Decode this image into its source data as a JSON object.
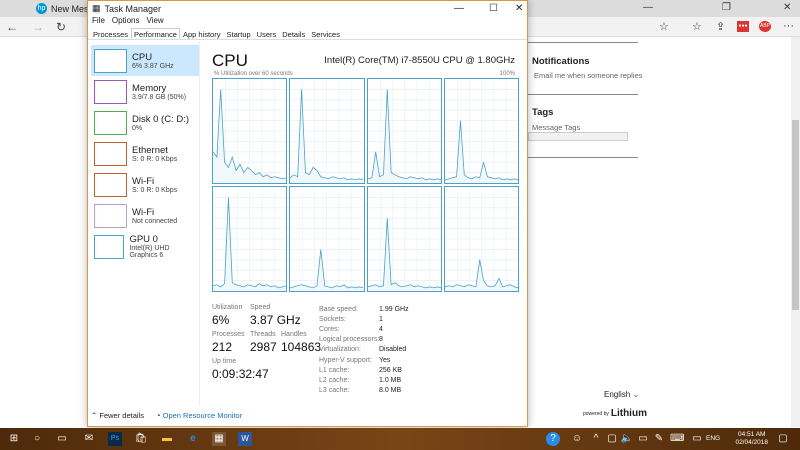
{
  "browser": {
    "tab_title": "New Message",
    "heading_notifications": "Notifications",
    "email_option": "Email me when someone replies",
    "heading_tags": "Tags",
    "tags_label": "Message Tags",
    "language": "English",
    "powered_by": "powered by",
    "brand": "Lithium"
  },
  "taskmgr": {
    "title": "Task Manager",
    "menu": [
      "File",
      "Options",
      "View"
    ],
    "tabs": [
      "Processes",
      "Performance",
      "App history",
      "Startup",
      "Users",
      "Details",
      "Services"
    ],
    "active_tab": 1,
    "sidebar": [
      {
        "name": "CPU",
        "sub": "6% 3.87 GHz",
        "color": "#4ba1c6"
      },
      {
        "name": "Memory",
        "sub": "3.9/7.8 GB (50%)",
        "color": "#9b59b6"
      },
      {
        "name": "Disk 0 (C: D:)",
        "sub": "0%",
        "color": "#4caf50"
      },
      {
        "name": "Ethernet",
        "sub": "S: 0 R: 0 Kbps",
        "color": "#c0622b"
      },
      {
        "name": "Wi-Fi",
        "sub": "S: 0 R: 0 Kbps",
        "color": "#c0622b"
      },
      {
        "name": "Wi-Fi",
        "sub": "Not connected",
        "color": "#c0a0c0"
      },
      {
        "name": "GPU 0",
        "sub": "Intel(R) UHD Graphics 6",
        "color": "#4ba1c6"
      }
    ],
    "main": {
      "title": "CPU",
      "cpu_name": "Intel(R) Core(TM) i7-8550U CPU @ 1.80GHz",
      "graph_label": "% Utilization over 60 seconds",
      "graph_max": "100%",
      "stats": {
        "util_label": "Utilization",
        "util": "6%",
        "speed_label": "Speed",
        "speed": "3.87 GHz",
        "proc_label": "Processes",
        "proc": "212",
        "threads_label": "Threads",
        "threads": "2987",
        "handles_label": "Handles",
        "handles": "104863",
        "uptime_label": "Up time",
        "uptime": "0:09:32:47"
      },
      "details": [
        [
          "Base speed:",
          "1.99 GHz"
        ],
        [
          "Sockets:",
          "1"
        ],
        [
          "Cores:",
          "4"
        ],
        [
          "Logical processors:",
          "8"
        ],
        [
          "Virtualization:",
          "Disabled"
        ],
        [
          "Hyper-V support:",
          "Yes"
        ],
        [
          "L1 cache:",
          "256 KB"
        ],
        [
          "L2 cache:",
          "1.0 MB"
        ],
        [
          "L3 cache:",
          "8.0 MB"
        ]
      ]
    },
    "footer": {
      "fewer": "Fewer details",
      "monitor": "Open Resource Monitor"
    },
    "core_utilization": [
      [
        30,
        25,
        90,
        20,
        15,
        25,
        12,
        18,
        10,
        15,
        12,
        8,
        10,
        6,
        8,
        5,
        6,
        5,
        4,
        5
      ],
      [
        5,
        8,
        6,
        90,
        10,
        8,
        15,
        12,
        6,
        5,
        4,
        6,
        5,
        4,
        5,
        3,
        4,
        3,
        4,
        3
      ],
      [
        4,
        5,
        30,
        6,
        8,
        90,
        10,
        8,
        6,
        5,
        4,
        6,
        5,
        4,
        5,
        3,
        4,
        3,
        4,
        3
      ],
      [
        3,
        4,
        5,
        6,
        60,
        8,
        5,
        4,
        6,
        5,
        20,
        6,
        5,
        4,
        5,
        3,
        4,
        3,
        4,
        3
      ],
      [
        5,
        6,
        4,
        7,
        90,
        8,
        6,
        5,
        4,
        6,
        5,
        4,
        7,
        5,
        6,
        4,
        5,
        3,
        4,
        5
      ],
      [
        3,
        4,
        5,
        6,
        5,
        4,
        3,
        5,
        40,
        5,
        4,
        3,
        5,
        4,
        6,
        3,
        4,
        3,
        4,
        3
      ],
      [
        4,
        5,
        6,
        4,
        5,
        70,
        6,
        8,
        5,
        4,
        5,
        6,
        4,
        5,
        4,
        3,
        4,
        3,
        4,
        3
      ],
      [
        4,
        5,
        4,
        6,
        5,
        4,
        6,
        5,
        4,
        30,
        10,
        5,
        4,
        5,
        12,
        4,
        5,
        6,
        4,
        3
      ]
    ]
  },
  "taskbar": {
    "time": "04:51 AM",
    "date": "02/04/2018",
    "lang": "ENG"
  }
}
